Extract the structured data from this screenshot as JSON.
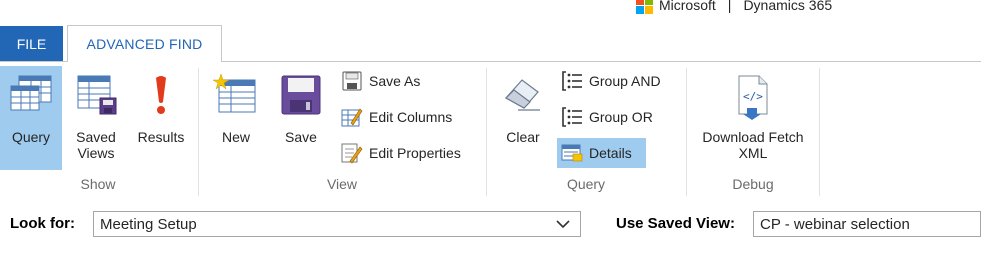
{
  "brand": {
    "company": "Microsoft",
    "separator": "|",
    "product": "Dynamics 365",
    "logo_colors": [
      "#f25022",
      "#7fba00",
      "#00a4ef",
      "#ffb900"
    ]
  },
  "tabs": {
    "file": "FILE",
    "advanced_find": "ADVANCED FIND"
  },
  "ribbon": {
    "show": {
      "label": "Show",
      "query": "Query",
      "saved_views_line1": "Saved",
      "saved_views_line2": "Views",
      "results": "Results"
    },
    "view": {
      "label": "View",
      "new": "New",
      "save": "Save",
      "save_as": "Save As",
      "edit_columns": "Edit Columns",
      "edit_properties": "Edit Properties"
    },
    "query": {
      "label": "Query",
      "clear": "Clear",
      "group_and": "Group AND",
      "group_or": "Group OR",
      "details": "Details"
    },
    "debug": {
      "label": "Debug",
      "download_line1": "Download Fetch",
      "download_line2": "XML"
    }
  },
  "filters": {
    "look_for_label": "Look for:",
    "look_for_value": "Meeting Setup",
    "use_saved_view_label": "Use Saved View:",
    "use_saved_view_value": "CP - webinar selection"
  },
  "colors": {
    "accent": "#2266b6",
    "selected": "#9ecbee"
  }
}
